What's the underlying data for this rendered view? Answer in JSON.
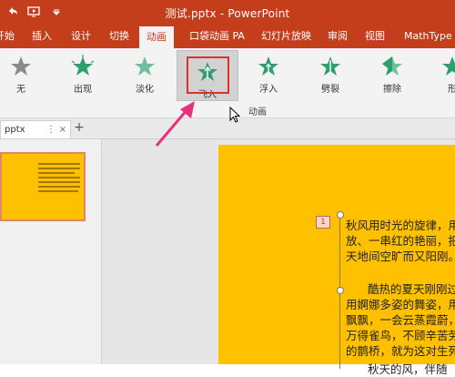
{
  "titlebar": {
    "title": "测试.pptx - PowerPoint",
    "bg_color": "#c43e1c"
  },
  "tabs": [
    {
      "label": "开始"
    },
    {
      "label": "插入"
    },
    {
      "label": "设计"
    },
    {
      "label": "切换"
    },
    {
      "label": "动画",
      "active": true
    },
    {
      "label": "口袋动画 PA"
    },
    {
      "label": "幻灯片放映"
    },
    {
      "label": "审阅"
    },
    {
      "label": "视图"
    },
    {
      "label": "MathType"
    }
  ],
  "effects": [
    {
      "label": "无",
      "icon": "star-gray-icon"
    },
    {
      "label": "出现",
      "icon": "star-burst-green-icon"
    },
    {
      "label": "淡化",
      "icon": "star-fade-green-icon"
    },
    {
      "label": "飞入",
      "icon": "star-flyin-green-icon",
      "selected": true
    },
    {
      "label": "浮入",
      "icon": "star-float-green-icon"
    },
    {
      "label": "劈裂",
      "icon": "star-split-green-icon"
    },
    {
      "label": "擦除",
      "icon": "star-wipe-green-icon"
    },
    {
      "label": "形",
      "icon": "star-shape-green-icon"
    }
  ],
  "group_label": "动画",
  "doc_tab": {
    "label": "pptx",
    "more": "⋮",
    "close": "×",
    "add": "+"
  },
  "slide": {
    "anim_badge": "1",
    "paragraphs": [
      [
        "秋风用时光的旋律，用",
        "放、一串红的艳丽，把",
        "天地间空旷而又阳刚。"
      ],
      [
        "酷热的夏天刚刚过",
        "用婀娜多姿的舞姿，用",
        "飘飘，一会云蒸霞蔚，",
        "万得雀鸟，不顾辛苦劳",
        "的鹊桥，就为这对生死"
      ],
      [
        "秋天的风，伴随"
      ]
    ],
    "bg_color": "#ffc000"
  },
  "accent": {
    "highlight_box": "#e0302a",
    "arrow": "#e8317a"
  }
}
